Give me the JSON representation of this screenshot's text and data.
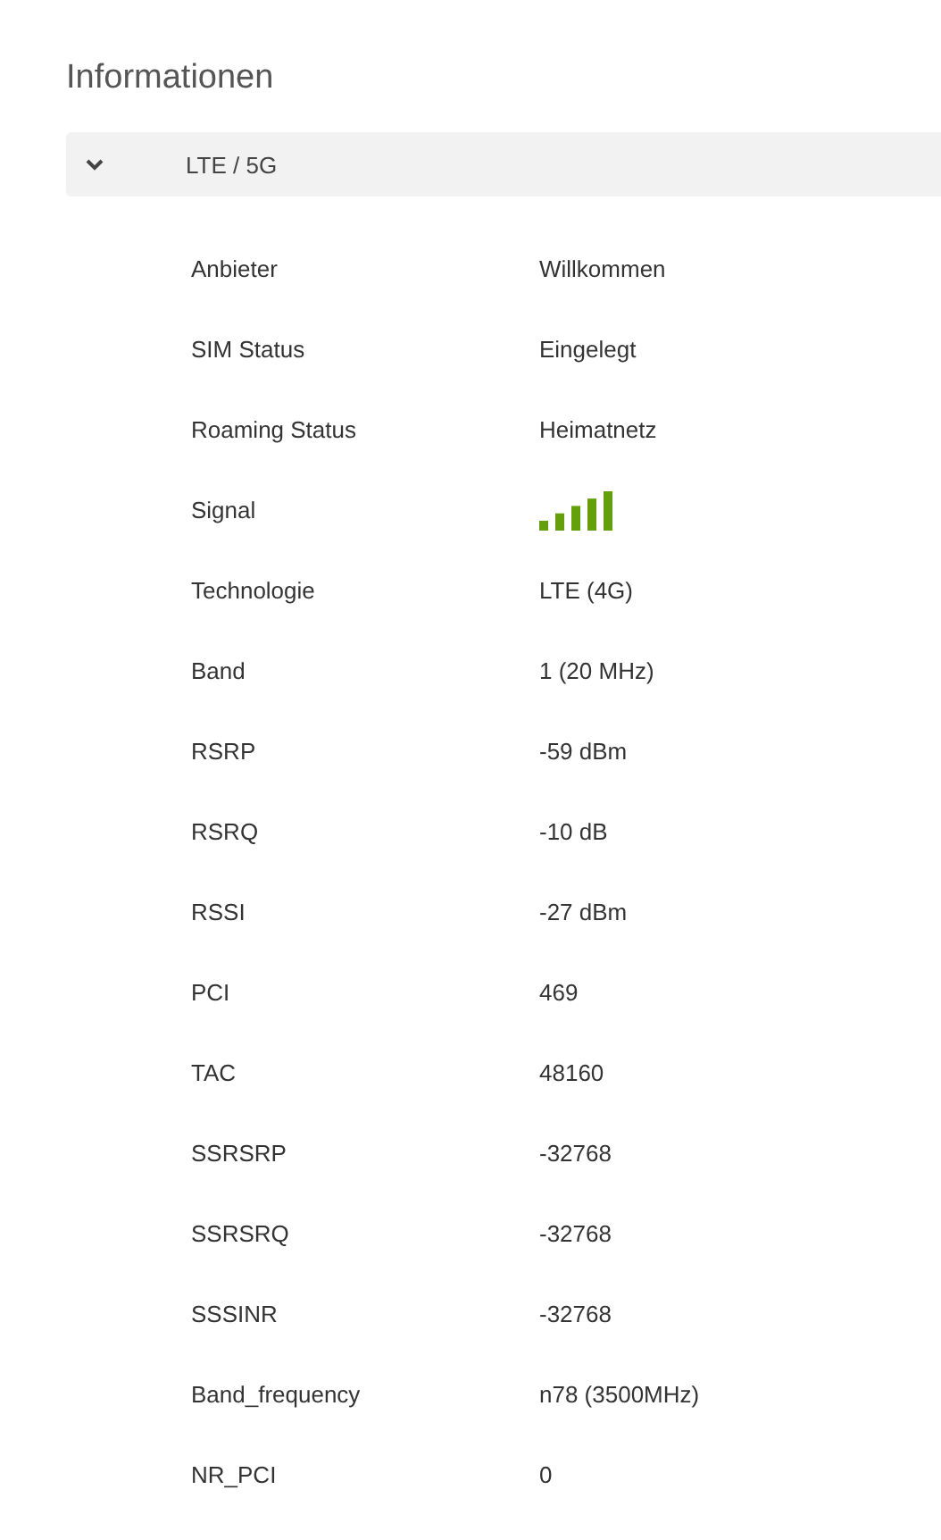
{
  "title": "Informationen",
  "section": {
    "label": "LTE / 5G",
    "expanded": true,
    "rows": [
      {
        "label": "Anbieter",
        "value": "Willkommen",
        "kind": "text"
      },
      {
        "label": "SIM Status",
        "value": "Eingelegt",
        "kind": "text"
      },
      {
        "label": "Roaming Status",
        "value": "Heimatnetz",
        "kind": "text"
      },
      {
        "label": "Signal",
        "kind": "signal"
      },
      {
        "label": "Technologie",
        "value": "LTE (4G)",
        "kind": "text"
      },
      {
        "label": "Band",
        "value": "1 (20 MHz)",
        "kind": "text"
      },
      {
        "label": "RSRP",
        "value": "-59 dBm",
        "kind": "text"
      },
      {
        "label": "RSRQ",
        "value": "-10 dB",
        "kind": "text"
      },
      {
        "label": "RSSI",
        "value": "-27 dBm",
        "kind": "text"
      },
      {
        "label": "PCI",
        "value": "469",
        "kind": "text"
      },
      {
        "label": "TAC",
        "value": "48160",
        "kind": "text"
      },
      {
        "label": "SSRSRP",
        "value": "-32768",
        "kind": "text"
      },
      {
        "label": "SSRSRQ",
        "value": "-32768",
        "kind": "text"
      },
      {
        "label": "SSSINR",
        "value": "-32768",
        "kind": "text"
      },
      {
        "label": "Band_frequency",
        "value": "n78 (3500MHz)",
        "kind": "text"
      },
      {
        "label": "NR_PCI",
        "value": "0",
        "kind": "text"
      }
    ]
  }
}
